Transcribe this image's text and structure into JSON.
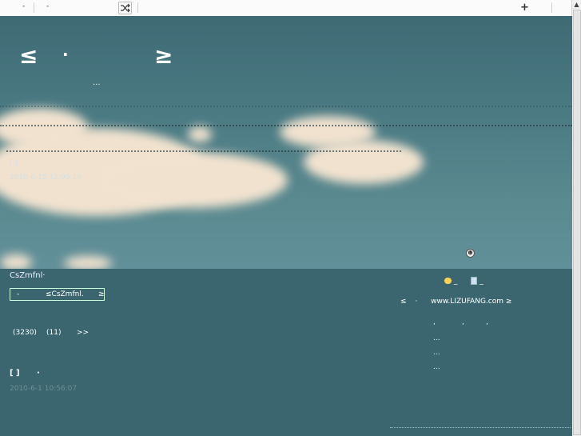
{
  "browser": {
    "dropdown1": "-",
    "dropdown2": "-",
    "add": "+"
  },
  "hero": {
    "left_glyph": "≤",
    "dot": "·",
    "right_glyph": "≥",
    "ellipsis": "...",
    "brackets": "[ ]",
    "date": "2010-6-15 12:00:19"
  },
  "sidebar": {
    "site_name": "CsZmfnl·",
    "search_left": "-",
    "search_mid": "≤CsZmfnl.",
    "search_right": "≥",
    "count_a": "(3230)",
    "count_b": "(11)",
    "more": ">>",
    "post_brackets": "[ ]",
    "post_dot": "·",
    "post_date": "2010-6-1 10:56:07"
  },
  "right": {
    "icon_text_1": "_",
    "icon_text_2": "_",
    "site_prefix": "≤",
    "site_dot": "·",
    "site_url": "www.LIZUFANG.com",
    "site_suffix": "≥",
    "row1": ",",
    "row2": ",",
    "row3": ",",
    "ell1": "...",
    "ell2": "...",
    "ell3": "..."
  }
}
